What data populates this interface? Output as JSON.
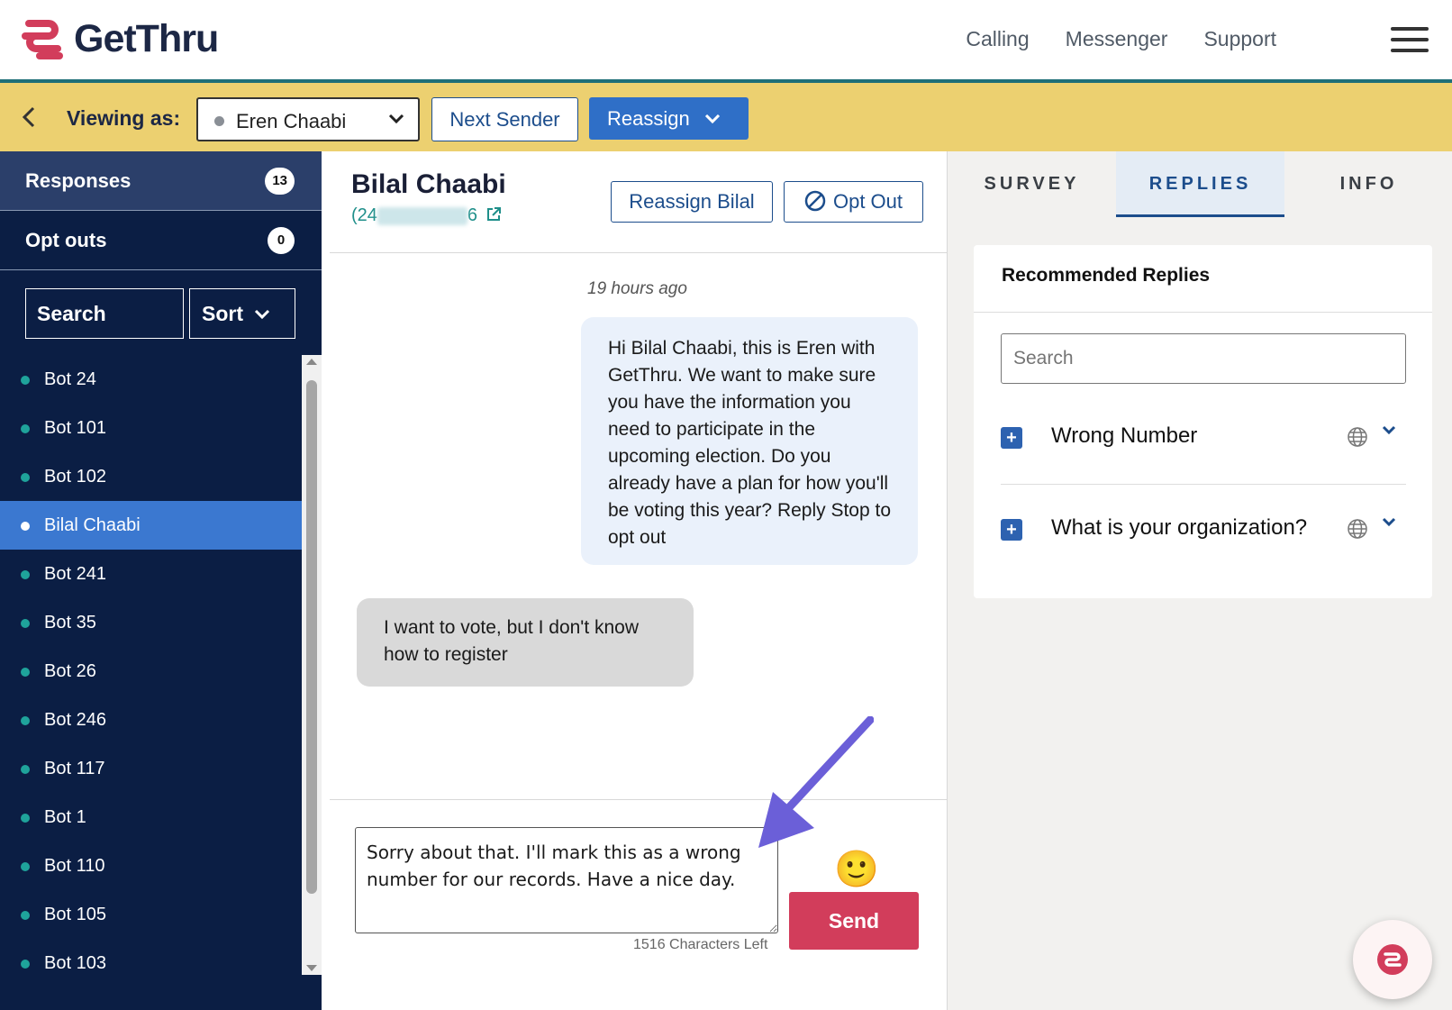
{
  "header": {
    "brand": "GetThru",
    "nav": [
      "Calling",
      "Messenger",
      "Support"
    ],
    "menu_icon": "hamburger-icon"
  },
  "viewbar": {
    "viewing_label": "Viewing as:",
    "sender": "Eren Chaabi",
    "next_sender": "Next Sender",
    "reassign": "Reassign"
  },
  "sidebar": {
    "tabs": [
      {
        "label": "Responses",
        "count": "13"
      },
      {
        "label": "Opt outs",
        "count": "0"
      }
    ],
    "search_label": "Search",
    "sort_label": "Sort",
    "items": [
      "Bot 24",
      "Bot 101",
      "Bot 102",
      "Bilal Chaabi",
      "Bot 241",
      "Bot 35",
      "Bot 26",
      "Bot 246",
      "Bot 117",
      "Bot 1",
      "Bot 110",
      "Bot 105",
      "Bot 103"
    ],
    "active_index": 3
  },
  "conversation": {
    "contact_name": "Bilal Chaabi",
    "phone_start": "(24",
    "phone_end": "6",
    "reassign_contact": "Reassign Bilal",
    "opt_out": "Opt Out",
    "timestamp": "19 hours ago",
    "outgoing": "Hi Bilal Chaabi, this is Eren with GetThru. We want to make sure you have the information you need to participate in the upcoming election. Do you already have a plan for how you'll be voting this year? Reply Stop to opt out",
    "incoming": "I want to vote, but I don't know how to register",
    "draft": "Sorry about that. I'll mark this as a wrong number for our records. Have a nice day.",
    "chars_left": "1516 Characters Left",
    "emoji": "🙂",
    "send": "Send"
  },
  "right_panel": {
    "tabs": [
      "SURVEY",
      "REPLIES",
      "INFO"
    ],
    "active_tab": "REPLIES",
    "card_title": "Recommended Replies",
    "search_placeholder": "Search",
    "replies": [
      "Wrong Number",
      "What is your organization?"
    ]
  },
  "colors": {
    "navy": "#0b1e44",
    "yellow_bar": "#ecd070",
    "primary_blue": "#2f6fc7",
    "send_red": "#d23d5b",
    "teal_dot": "#1fa39b",
    "arrow": "#6b5fd8"
  }
}
